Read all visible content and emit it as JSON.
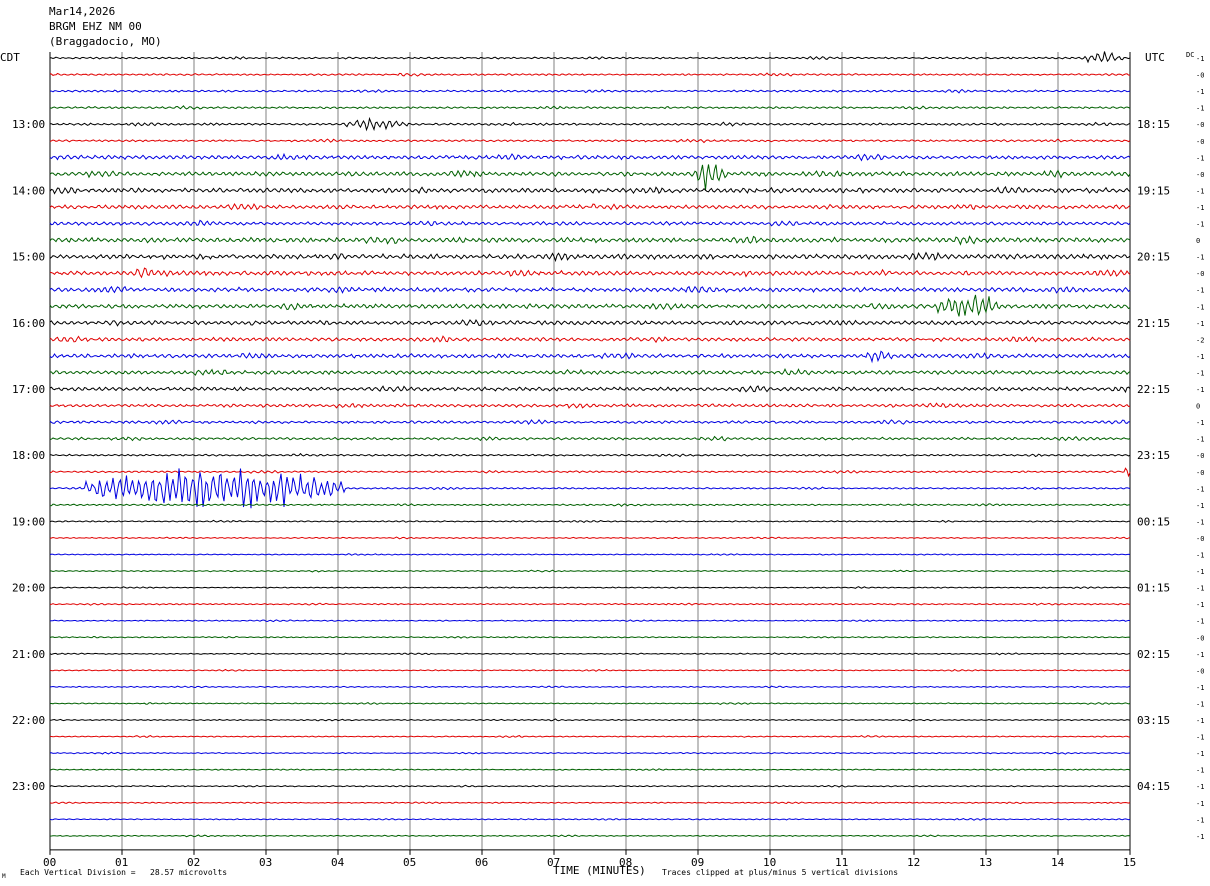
{
  "header": {
    "date": "Mar14,2026",
    "station": "BRGM EHZ NM 00",
    "location": "(Braggadocio, MO)"
  },
  "left_tz": "CDT",
  "right_tz": "UTC",
  "dc_label": "DC",
  "footer": {
    "division": "Each Vertical Division =   28.57 microvolts",
    "clip_note": "Traces clipped at plus/minus 5 vertical divisions",
    "corner_mark": "M"
  },
  "colors": {
    "trace": [
      "#000000",
      "#e00000",
      "#0000e0",
      "#006000"
    ],
    "grid": "#808080"
  },
  "chart_data": {
    "type": "helicorder",
    "xlabel": "TIME (MINUTES)",
    "xlim": [
      0,
      15
    ],
    "x_ticks": [
      "00",
      "01",
      "02",
      "03",
      "04",
      "05",
      "06",
      "07",
      "08",
      "09",
      "10",
      "11",
      "12",
      "13",
      "14",
      "15"
    ],
    "rows": 48,
    "minutes_per_row": 15,
    "left_hour_labels": [
      {
        "row": 4,
        "label": "13:00"
      },
      {
        "row": 8,
        "label": "14:00"
      },
      {
        "row": 12,
        "label": "15:00"
      },
      {
        "row": 16,
        "label": "16:00"
      },
      {
        "row": 20,
        "label": "17:00"
      },
      {
        "row": 24,
        "label": "18:00"
      },
      {
        "row": 28,
        "label": "19:00"
      },
      {
        "row": 32,
        "label": "20:00"
      },
      {
        "row": 36,
        "label": "21:00"
      },
      {
        "row": 40,
        "label": "22:00"
      },
      {
        "row": 44,
        "label": "23:00"
      }
    ],
    "right_hour_labels": [
      {
        "row": 4,
        "label": "18:15"
      },
      {
        "row": 8,
        "label": "19:15"
      },
      {
        "row": 12,
        "label": "20:15"
      },
      {
        "row": 16,
        "label": "21:15"
      },
      {
        "row": 20,
        "label": "22:15"
      },
      {
        "row": 24,
        "label": "23:15"
      },
      {
        "row": 28,
        "label": "00:15"
      },
      {
        "row": 32,
        "label": "01:15"
      },
      {
        "row": 36,
        "label": "02:15"
      },
      {
        "row": 40,
        "label": "03:15"
      },
      {
        "row": 44,
        "label": "04:15"
      }
    ],
    "dc_offsets": [
      "-1",
      "-0",
      "-1",
      "-1",
      "-0",
      "-0",
      "-1",
      "-0",
      "-1",
      "-1",
      "-1",
      "0",
      "-1",
      "-0",
      "-1",
      "-1",
      "-1",
      "-2",
      "-1",
      "-1",
      "-1",
      "0",
      "-1",
      "-1",
      "-0",
      "-0",
      "-1",
      "-1",
      "-1",
      "-0",
      "-1",
      "-1",
      "-1",
      "-1",
      "-1",
      "-0",
      "-1",
      "-0",
      "-1",
      "-1",
      "-1",
      "-1",
      "-1",
      "-1",
      "-1",
      "-1",
      "-1",
      "-1"
    ],
    "row_noise_level": [
      0.8,
      0.8,
      0.9,
      0.9,
      1.0,
      0.9,
      1.8,
      2.0,
      2.2,
      1.8,
      1.6,
      2.2,
      2.2,
      2.0,
      2.0,
      2.0,
      1.8,
      1.7,
      1.8,
      1.7,
      1.7,
      1.4,
      1.2,
      1.1,
      0.8,
      0.8,
      0.7,
      0.7,
      0.6,
      0.5,
      0.5,
      0.5,
      0.5,
      0.6,
      0.5,
      0.5,
      0.5,
      0.5,
      0.5,
      0.5,
      0.5,
      0.5,
      0.5,
      0.5,
      0.5,
      0.5,
      0.5,
      0.5
    ],
    "events": [
      {
        "row": 0,
        "minute": 14.3,
        "duration": 0.6,
        "amplitude": 5
      },
      {
        "row": 4,
        "minute": 4.1,
        "duration": 0.9,
        "amplitude": 6
      },
      {
        "row": 7,
        "minute": 8.9,
        "duration": 0.5,
        "amplitude": 12
      },
      {
        "row": 13,
        "minute": 1.1,
        "duration": 0.4,
        "amplitude": 6
      },
      {
        "row": 15,
        "minute": 12.3,
        "duration": 0.9,
        "amplitude": 12
      },
      {
        "row": 18,
        "minute": 11.3,
        "duration": 0.4,
        "amplitude": 6
      },
      {
        "row": 26,
        "minute": 0.5,
        "duration": 3.6,
        "amplitude": 18
      },
      {
        "row": 25,
        "minute": 14.9,
        "duration": 0.2,
        "amplitude": 8
      }
    ]
  }
}
